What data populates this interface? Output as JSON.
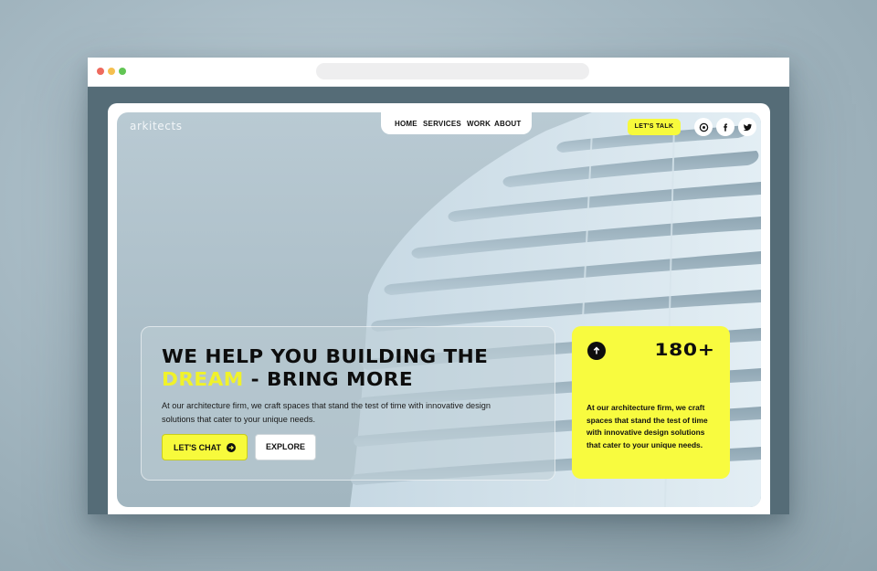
{
  "site": {
    "logo": "arkitects",
    "nav": [
      {
        "label": "HOME"
      },
      {
        "label": "SERVICES"
      },
      {
        "label": "WORK"
      },
      {
        "label": "ABOUT"
      }
    ],
    "cta_label": "LET'S TALK",
    "social_icons": [
      "pinterest-icon",
      "facebook-icon",
      "twitter-icon"
    ]
  },
  "hero": {
    "headline_line1": "WE HELP YOU BUILDING THE",
    "headline_accent": "DREAM",
    "headline_rest": " - BRING MORE",
    "description": "At our architecture firm, we craft spaces that stand the test of time with innovative design solutions that cater to your unique needs.",
    "primary_button": "LET'S CHAT",
    "secondary_button": "EXPLORE"
  },
  "stat_card": {
    "number": "180+",
    "text": "At our architecture firm, we craft spaces that stand the test of time with innovative design solutions that cater to your unique needs."
  },
  "colors": {
    "accent": "#f7fa3c",
    "dark": "#0e0e0e",
    "frame": "#556c77"
  }
}
